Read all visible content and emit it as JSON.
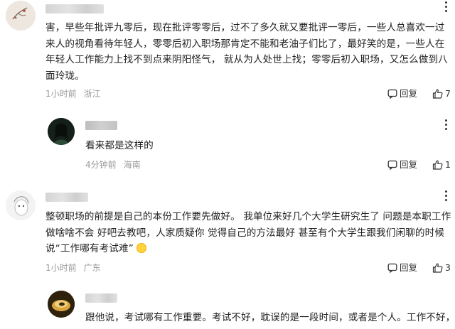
{
  "comments": [
    {
      "text": "害，早些年批评九零后，现在批评零零后，过不了多久就又要批评一零后，一些人总喜欢一过来人的视角看待年轻人，零零后初入职场那肯定不能和老油子们比了，最好笑的是，一些人在年轻人工作能力上找不到点来阴阳怪气， 就从为人处世上找；零零后初入职场，又怎么做到八面玲珑。",
      "time": "1小时前",
      "location": "浙江",
      "reply_label": "回复",
      "likes": "7"
    },
    {
      "text": "看来都是这样的",
      "time": "4分钟前",
      "location": "海南",
      "reply_label": "回复",
      "likes": "1"
    },
    {
      "text": "整顿职场的前提是自己的本份工作要先做好。 我单位来好几个大学生研究生了 问题是本职工作做啥啥不会 好吧去教吧，人家质疑你 觉得自己的方法最好 甚至有个大学生跟我们闲聊的时候说“工作哪有考试难”",
      "time": "1小时前",
      "location": "广东",
      "reply_label": "回复",
      "likes": "3"
    },
    {
      "text": "跟他说，考试哪有工作重要。考试不好，耽误的是一段时间，或者是个人。工作不好，"
    }
  ],
  "icons": {
    "more": "more-vertical-icon",
    "reply": "comment-bubble-icon",
    "like": "thumbs-up-icon",
    "emoji": "sweat-smile-emoji-icon"
  },
  "colors": {
    "meta": "#999999",
    "text": "#222222"
  }
}
